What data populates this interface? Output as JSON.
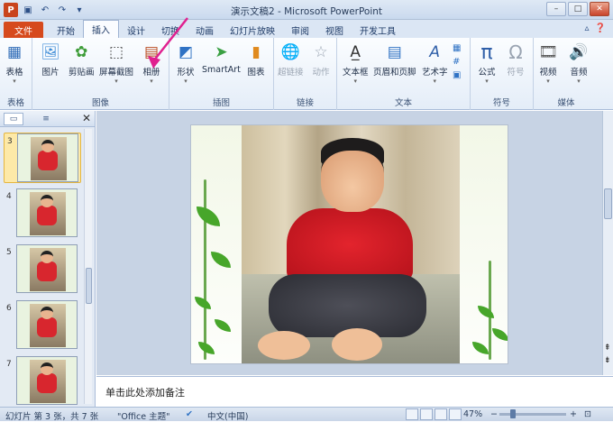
{
  "window": {
    "title": "演示文稿2 - Microsoft PowerPoint"
  },
  "qat": {
    "save": "save-icon",
    "undo": "undo-icon",
    "redo": "redo-icon"
  },
  "tabs": [
    {
      "label": "文件"
    },
    {
      "label": "开始"
    },
    {
      "label": "插入"
    },
    {
      "label": "设计"
    },
    {
      "label": "切换"
    },
    {
      "label": "动画"
    },
    {
      "label": "幻灯片放映"
    },
    {
      "label": "审阅"
    },
    {
      "label": "视图"
    },
    {
      "label": "开发工具"
    }
  ],
  "ribbon": {
    "table": {
      "btn": "表格",
      "group": "表格"
    },
    "images": {
      "picture": "图片",
      "clipart": "剪贴画",
      "screenshot": "屏幕截图",
      "album": "相册",
      "group": "图像"
    },
    "illus": {
      "shapes": "形状",
      "smartart": "SmartArt",
      "chart": "图表",
      "group": "插图"
    },
    "links": {
      "hyperlink": "超链接",
      "action": "动作",
      "group": "链接"
    },
    "text": {
      "textbox": "文本框",
      "headerfooter": "页眉和页脚",
      "wordart": "艺术字",
      "group": "文本"
    },
    "symbols": {
      "equation": "公式",
      "symbol": "符号",
      "group": "符号"
    },
    "media": {
      "video": "视频",
      "audio": "音频",
      "group": "媒体"
    }
  },
  "slides_pane": {
    "numbers": [
      "3",
      "4",
      "5",
      "6",
      "7"
    ],
    "selected": "3"
  },
  "notes": {
    "placeholder": "单击此处添加备注"
  },
  "status": {
    "slide_info": "幻灯片 第 3 张，共 7 张",
    "theme": "\"Office 主题\"",
    "language": "中文(中国)",
    "zoom": "47%"
  }
}
